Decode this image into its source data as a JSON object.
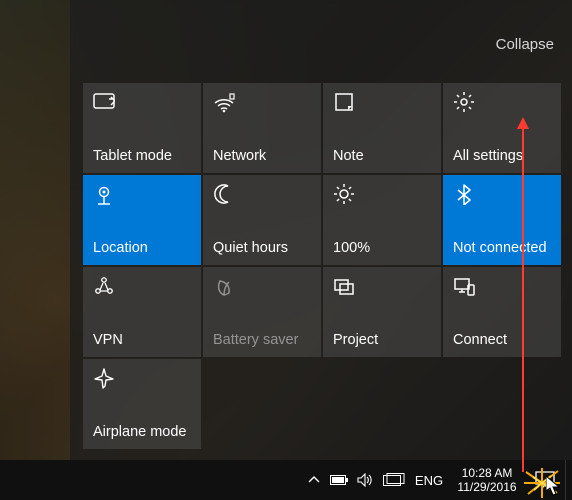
{
  "collapse_label": "Collapse",
  "tiles": [
    {
      "name": "tablet-mode",
      "label": "Tablet mode",
      "icon": "tablet-icon",
      "state": "normal"
    },
    {
      "name": "network",
      "label": "Network",
      "icon": "wifi-icon",
      "state": "normal"
    },
    {
      "name": "note",
      "label": "Note",
      "icon": "note-icon",
      "state": "normal"
    },
    {
      "name": "all-settings",
      "label": "All settings",
      "icon": "gear-icon",
      "state": "normal"
    },
    {
      "name": "location",
      "label": "Location",
      "icon": "location-icon",
      "state": "active"
    },
    {
      "name": "quiet-hours",
      "label": "Quiet hours",
      "icon": "moon-icon",
      "state": "normal"
    },
    {
      "name": "brightness",
      "label": "100%",
      "icon": "sun-icon",
      "state": "normal"
    },
    {
      "name": "bluetooth",
      "label": "Not connected",
      "icon": "bluetooth-icon",
      "state": "active"
    },
    {
      "name": "vpn",
      "label": "VPN",
      "icon": "vpn-icon",
      "state": "normal"
    },
    {
      "name": "battery-saver",
      "label": "Battery saver",
      "icon": "leaf-icon",
      "state": "disabled"
    },
    {
      "name": "project",
      "label": "Project",
      "icon": "project-icon",
      "state": "normal"
    },
    {
      "name": "connect",
      "label": "Connect",
      "icon": "connect-icon",
      "state": "normal"
    },
    {
      "name": "airplane-mode",
      "label": "Airplane mode",
      "icon": "airplane-icon",
      "state": "normal"
    }
  ],
  "taskbar": {
    "language": "ENG",
    "time": "10:28 AM",
    "date": "11/29/2016"
  },
  "annotation": {
    "arrow_color": "#ff3a2f"
  }
}
